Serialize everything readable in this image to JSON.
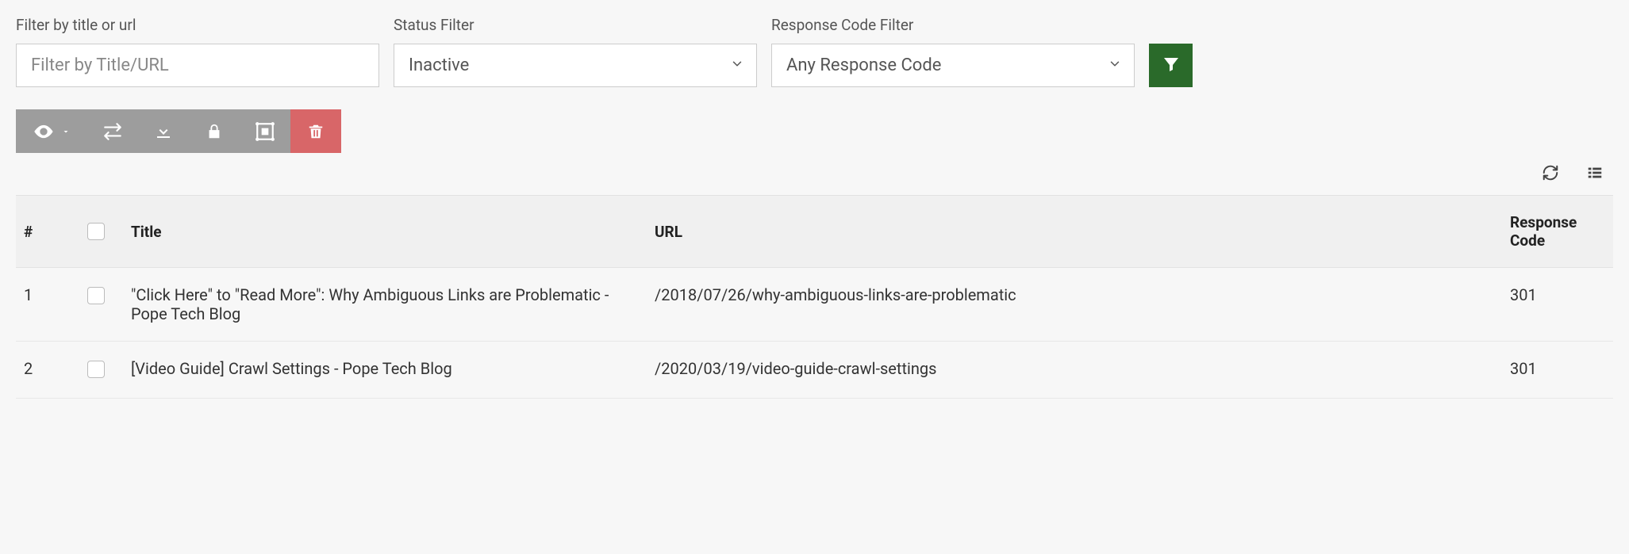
{
  "filters": {
    "title_url": {
      "label": "Filter by title or url",
      "placeholder": "Filter by Title/URL",
      "value": ""
    },
    "status": {
      "label": "Status Filter",
      "selected": "Inactive"
    },
    "response_code": {
      "label": "Response Code Filter",
      "selected": "Any Response Code"
    }
  },
  "toolbar_icons": {
    "visibility": "eye-icon",
    "swap": "swap-icon",
    "download": "download-icon",
    "lock": "lock-icon",
    "group": "group-icon",
    "delete": "trash-icon"
  },
  "table_action_icons": {
    "refresh": "refresh-icon",
    "columns": "columns-icon"
  },
  "table": {
    "columns": {
      "num": "#",
      "title": "Title",
      "url": "URL",
      "response_code": "Response Code"
    },
    "rows": [
      {
        "num": "1",
        "title": "\"Click Here\" to \"Read More\": Why Ambiguous Links are Problematic - Pope Tech Blog",
        "url": "/2018/07/26/why-ambiguous-links-are-problematic",
        "response_code": "301"
      },
      {
        "num": "2",
        "title": "[Video Guide] Crawl Settings - Pope Tech Blog",
        "url": "/2020/03/19/video-guide-crawl-settings",
        "response_code": "301"
      }
    ]
  }
}
